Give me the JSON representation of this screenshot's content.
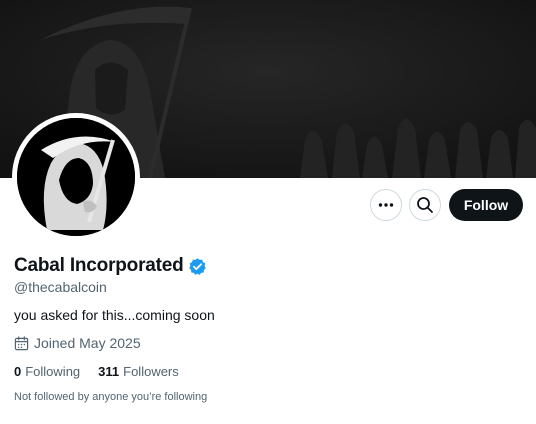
{
  "profile": {
    "display_name": "Cabal Incorporated",
    "handle": "@thecabalcoin",
    "bio": "you asked for this...coming soon",
    "joined": "Joined May 2025",
    "following_count": "0",
    "following_label": "Following",
    "followers_count": "311",
    "followers_label": "Followers",
    "followed_by_note": "Not followed by anyone you’re following"
  },
  "actions": {
    "follow_label": "Follow",
    "more_icon": "more-icon",
    "search_icon": "search-icon"
  },
  "colors": {
    "verified": "#1d9bf0",
    "follow_bg": "#0f1419",
    "secondary_text": "#536471"
  }
}
